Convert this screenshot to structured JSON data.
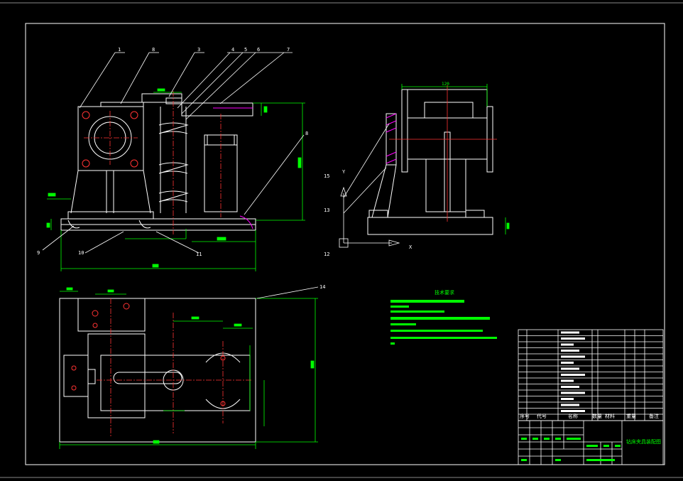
{
  "colors": {
    "background": "#000000",
    "line": "#ffffff",
    "dimension": "#00ff00",
    "centerline": "#ff0000",
    "hidden": "#ff00ff"
  },
  "balloons": [
    "1",
    "8",
    "3",
    "4",
    "5",
    "6",
    "7",
    "8",
    "9",
    "10",
    "11",
    "12",
    "13",
    "14",
    "15"
  ],
  "axis": {
    "y": "Y",
    "x": "X"
  },
  "notes": {
    "title": "技术要求"
  },
  "bom": {
    "header": [
      "序号",
      "代号",
      "名称",
      "数量",
      "材料",
      "重量",
      "备注"
    ]
  },
  "title_block": {
    "drawing_name": "钻床夹具装配图"
  },
  "side_dims": {
    "top_width": "120"
  }
}
